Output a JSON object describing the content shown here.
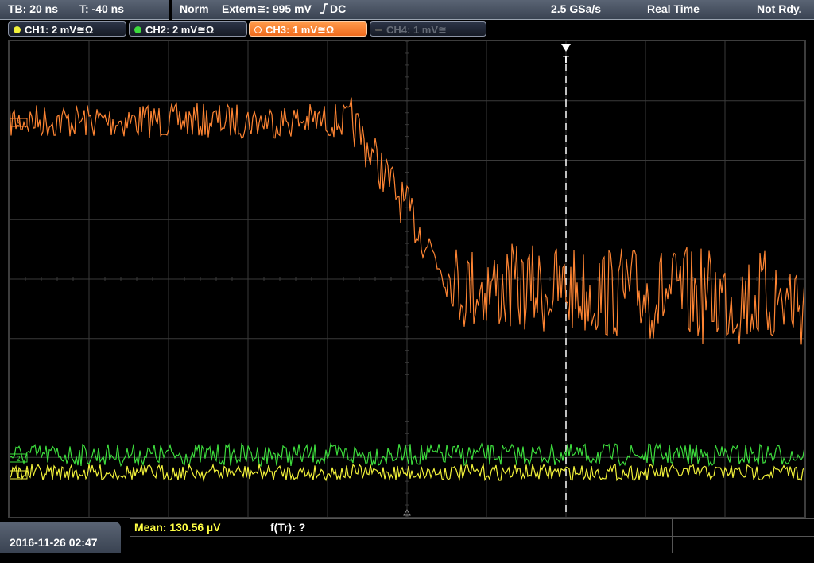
{
  "topbar": {
    "timebase": "TB: 20 ns",
    "trigger_pos": "T: -40 ns",
    "mode": "Norm",
    "trigger_source": "Extern≅: 995 mV",
    "trigger_coupling": "DC",
    "sample_rate": "2.5 GSa/s",
    "acq_mode": "Real Time",
    "status": "Not Rdy."
  },
  "channels": [
    {
      "label": "CH1: 2 mV≅Ω",
      "color": "#f2f23a",
      "state": "on"
    },
    {
      "label": "CH2: 2 mV≅Ω",
      "color": "#3ddc3d",
      "state": "on"
    },
    {
      "label": "CH3: 1 mV≅Ω",
      "color": "#ff8533",
      "state": "active"
    },
    {
      "label": "CH4: 1 mV≅",
      "color": "#6b6f78",
      "state": "off"
    }
  ],
  "markers": {
    "trigger_marker": "T",
    "ch3_marker": "3",
    "ch2_marker": "2",
    "ch1_marker": "1"
  },
  "colors": {
    "ch1": "#f2f23a",
    "ch2": "#3ddc3d",
    "ch3": "#ff8533",
    "grid": "#3a3a3a",
    "trigger_line": "#ffffff"
  },
  "bottombar": {
    "datetime": "2016-11-26 02:47",
    "measure1": "Mean: 130.56 µV",
    "measure2": "f(Tr): ?"
  }
}
